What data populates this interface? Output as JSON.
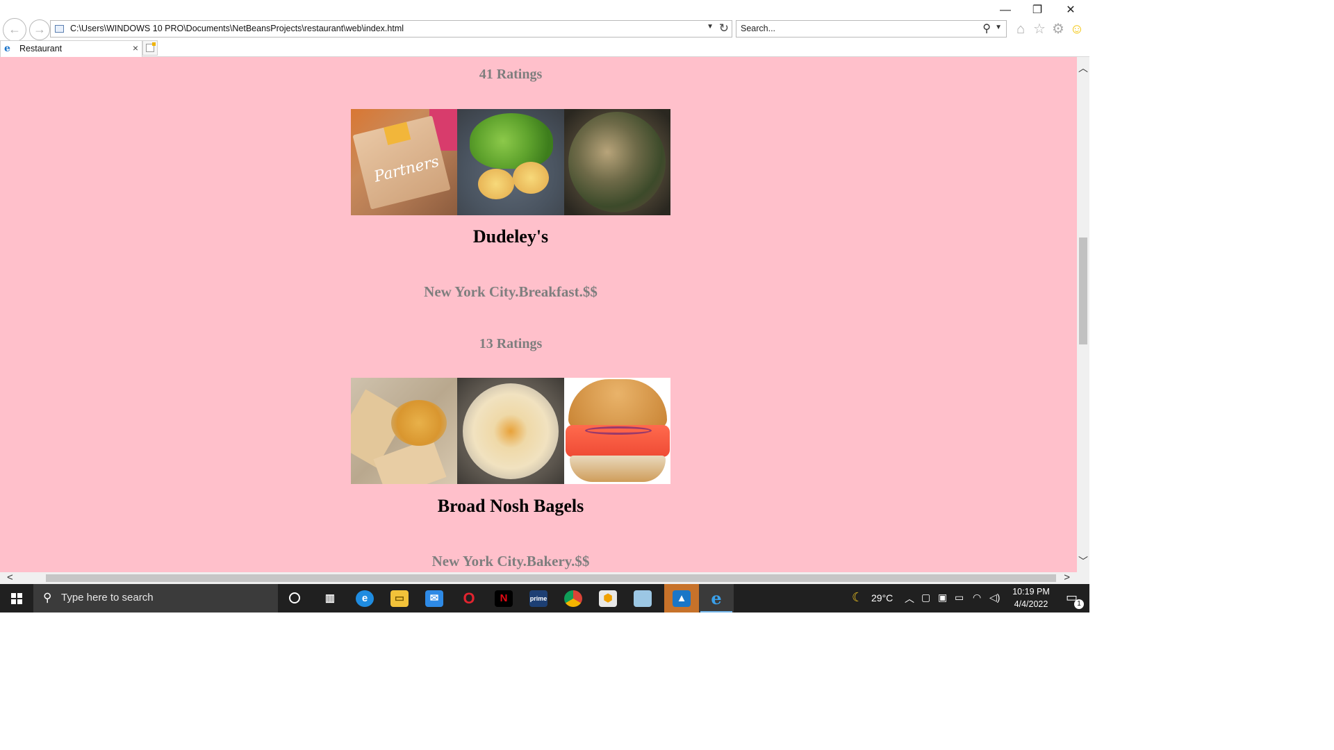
{
  "browser": {
    "address": "C:\\Users\\WINDOWS 10 PRO\\Documents\\NetBeansProjects\\restaurant\\web\\index.html",
    "search_placeholder": "Search...",
    "tab_title": "Restaurant",
    "window_buttons": {
      "minimize": "—",
      "restore": "❐",
      "close": "✕"
    }
  },
  "page": {
    "background": "#ffc0cb",
    "top_ratings": "41 Ratings",
    "restaurants": [
      {
        "name": "Dudeley's",
        "meta": "New York City.Breakfast.$$",
        "ratings": "13 Ratings",
        "photos": [
          "partners-coffee-bag-photo",
          "eggs-benedict-salad-photo",
          "brussels-sprouts-bowl-photo"
        ]
      },
      {
        "name": "Broad Nosh Bagels",
        "meta": "New York City.Bakery.$$",
        "photos": [
          "hummus-pita-photo",
          "hummus-plate-photo",
          "lox-bagel-photo"
        ]
      }
    ],
    "photo_row1_caption_text": "Partners"
  },
  "taskbar": {
    "search_placeholder": "Type here to search",
    "apps": [
      "cortana",
      "task-view",
      "edge",
      "file-explorer",
      "mail",
      "opera",
      "netflix",
      "prime-video",
      "chrome",
      "app-box",
      "notepad",
      "photos",
      "internet-explorer"
    ],
    "weather_temp": "29°C",
    "time": "10:19 PM",
    "date": "4/4/2022",
    "notification_count": "1"
  }
}
